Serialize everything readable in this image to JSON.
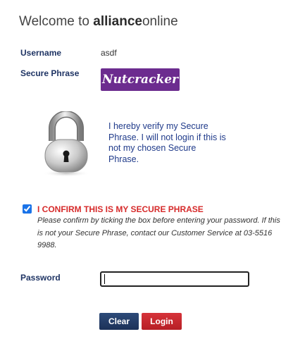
{
  "header": {
    "welcome_prefix": "Welcome to",
    "brand_bold": "alliance",
    "brand_rest": "online"
  },
  "account": {
    "username_label": "Username",
    "username_value": "asdf",
    "phrase_label": "Secure Phrase",
    "phrase_value": "Nutcracker"
  },
  "verify": {
    "text": "I hereby verify my Secure Phrase. I will not login if this is not my chosen Secure Phrase."
  },
  "confirm": {
    "checked": true,
    "title": "I CONFIRM THIS IS MY SECURE PHRASE",
    "note": "Please confirm by ticking the box before entering your password. If this is not your Secure Phrase, contact our Customer Service at 03-5516 9988."
  },
  "password": {
    "label": "Password",
    "value": ""
  },
  "buttons": {
    "clear": "Clear",
    "login": "Login"
  },
  "colors": {
    "label_text": "#1f3464",
    "phrase_bg": "#6c2c8f",
    "confirm_red": "#d62a2a",
    "clear_btn": "#1c3158",
    "login_btn": "#b71f25"
  },
  "icons": {
    "lock": "padlock-icon"
  }
}
